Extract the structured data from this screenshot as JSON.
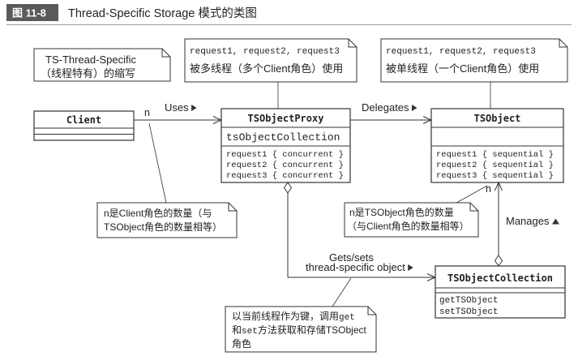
{
  "figure": {
    "number": "图 11-8",
    "title": "Thread-Specific Storage 模式的类图"
  },
  "classes": {
    "client": {
      "name": "Client"
    },
    "ts_object_proxy": {
      "name": "TSObjectProxy",
      "attributes": [
        "tsObjectCollection"
      ],
      "operations": [
        "request1 { concurrent }",
        "request2 { concurrent }",
        "request3 { concurrent }"
      ]
    },
    "ts_object": {
      "name": "TSObject",
      "operations": [
        "request1 { sequential }",
        "request2 { sequential }",
        "request3 { sequential }"
      ]
    },
    "ts_object_collection": {
      "name": "TSObjectCollection",
      "operations": [
        "getTSObject",
        "setTSObject"
      ]
    }
  },
  "associations": {
    "uses": {
      "label": "Uses",
      "label_icon": "triangle-right-icon",
      "multiplicity": "n"
    },
    "delegates": {
      "label": "Delegates",
      "label_icon": "triangle-right-icon"
    },
    "gets_sets": {
      "label_line1": "Gets/sets",
      "label_line2": "thread-specific object",
      "label_icon": "triangle-right-icon"
    },
    "manages": {
      "label": "Manages",
      "label_icon": "triangle-up-icon",
      "multiplicity": "n"
    }
  },
  "notes": {
    "ts_abbreviation": {
      "line1": "TS-Thread-Specific",
      "line2": "（线程特有）的缩写"
    },
    "proxy_requests": {
      "line1": "request1, request2, request3",
      "line2": "被多线程（多个Client角色）使用"
    },
    "ts_object_requests": {
      "line1": "request1, request2, request3",
      "line2": "被单线程（一个Client角色）使用"
    },
    "client_count": {
      "line1": "n是Client角色的数量（与",
      "line2": "TSObject角色的数量相等）"
    },
    "ts_object_count": {
      "line1": "n是TSObject角色的数量",
      "line2": "（与Client角色的数量相等）"
    },
    "thread_key": {
      "line1": [
        "以当前线程作为键，调用",
        "get"
      ],
      "line2": [
        "和",
        "set",
        "方法获取和存储TSObject"
      ],
      "line3": "角色"
    }
  },
  "colors": {
    "line": "#333333",
    "text": "#222222",
    "figure_tag_background": "#5a5a5a",
    "figure_tag_text": "#ffffff",
    "background": "#ffffff"
  }
}
